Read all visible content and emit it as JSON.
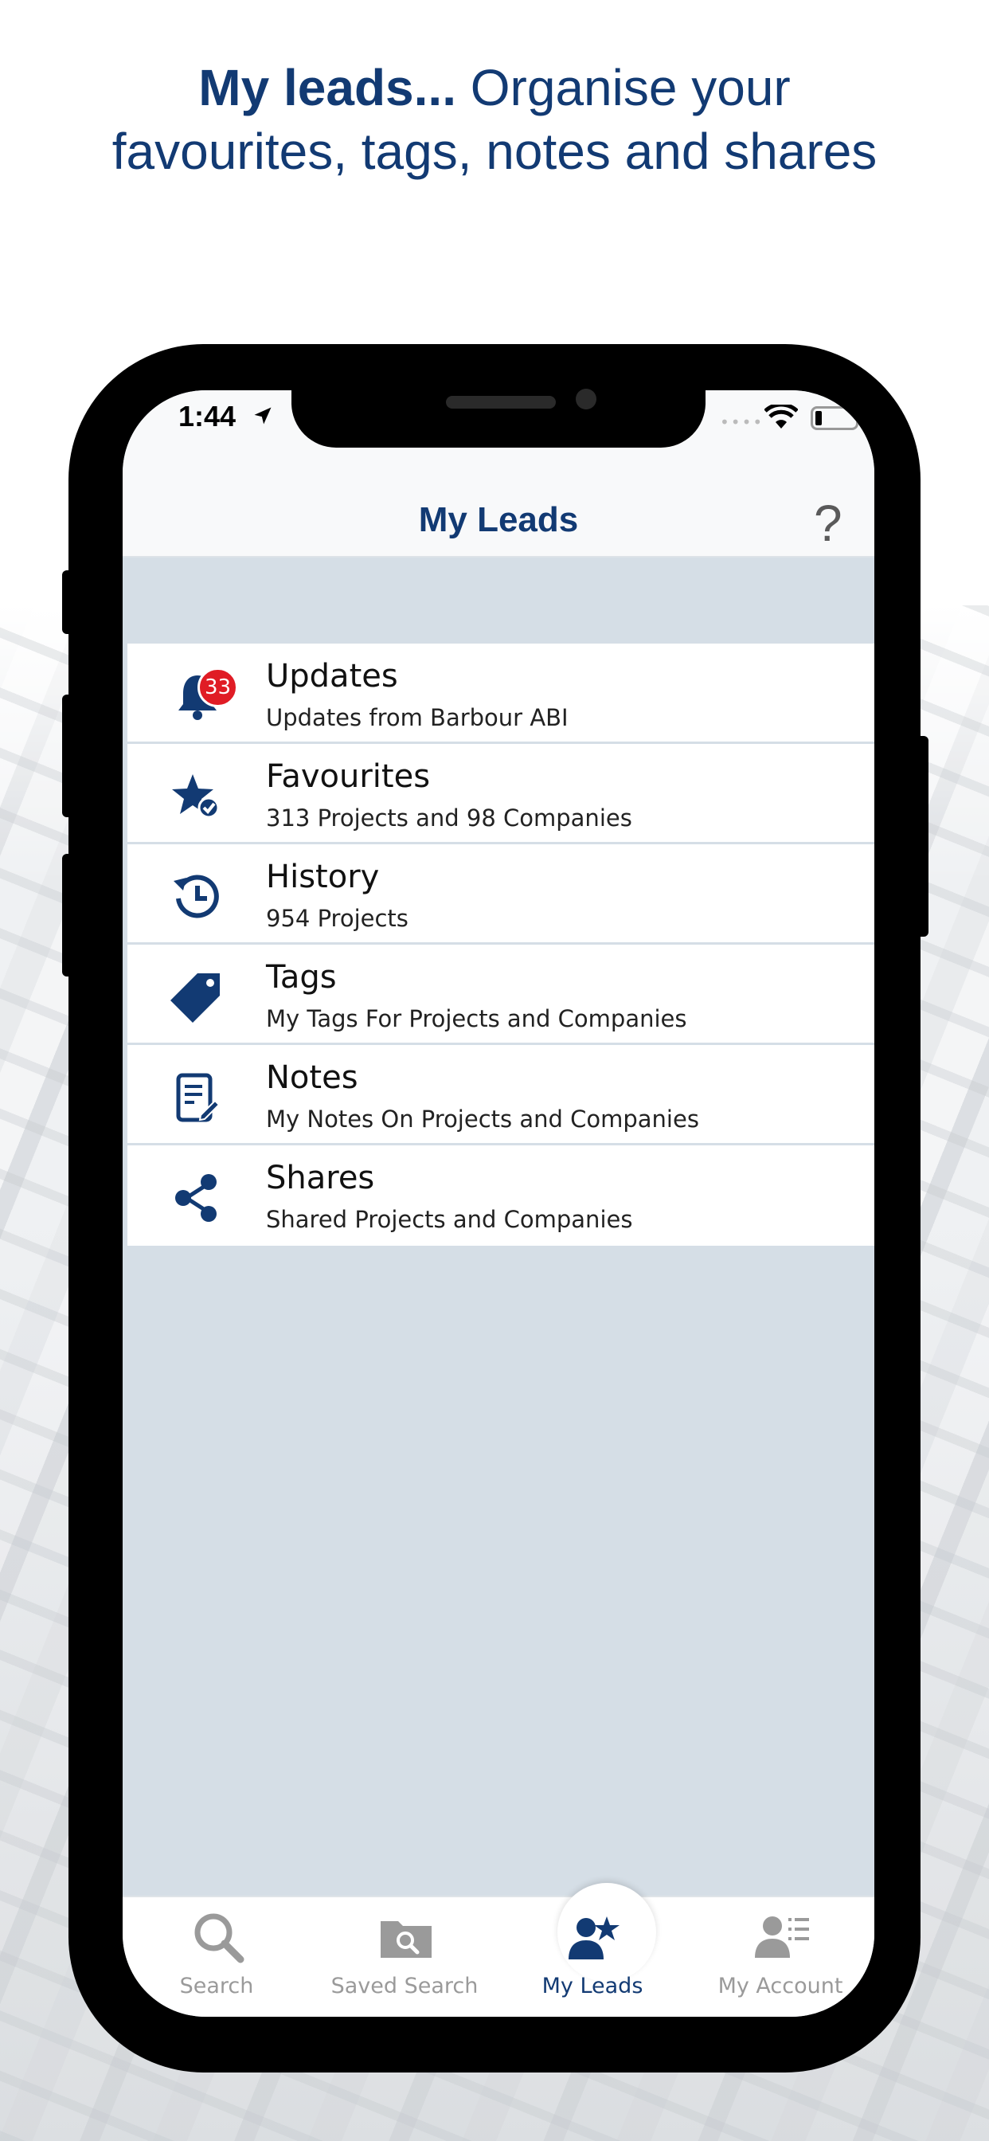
{
  "headline": {
    "bold": "My leads...",
    "line1_rest": " Organise your",
    "line2": "favourites, tags, notes and shares"
  },
  "status_bar": {
    "time": "1:44"
  },
  "nav": {
    "title": "My Leads",
    "help_label": "?"
  },
  "list": {
    "items": [
      {
        "title": "Updates",
        "subtitle": "Updates from Barbour ABI",
        "icon": "bell-icon",
        "badge": "33"
      },
      {
        "title": "Favourites",
        "subtitle": "313 Projects and 98 Companies",
        "icon": "star-check-icon"
      },
      {
        "title": "History",
        "subtitle": "954 Projects",
        "icon": "history-icon"
      },
      {
        "title": "Tags",
        "subtitle": "My Tags For Projects and Companies",
        "icon": "tag-icon"
      },
      {
        "title": "Notes",
        "subtitle": "My Notes On Projects and Companies",
        "icon": "note-icon"
      },
      {
        "title": "Shares",
        "subtitle": "Shared Projects and Companies",
        "icon": "share-icon"
      }
    ]
  },
  "tabbar": {
    "tabs": [
      {
        "label": "Search",
        "icon": "search-icon"
      },
      {
        "label": "Saved Search",
        "icon": "saved-search-folder-icon"
      },
      {
        "label": "My Leads",
        "icon": "my-leads-icon",
        "active": true
      },
      {
        "label": "My Account",
        "icon": "my-account-icon"
      }
    ]
  },
  "colors": {
    "brand": "#123a73",
    "badge": "#e01c25",
    "list_background": "#d5dee6"
  }
}
